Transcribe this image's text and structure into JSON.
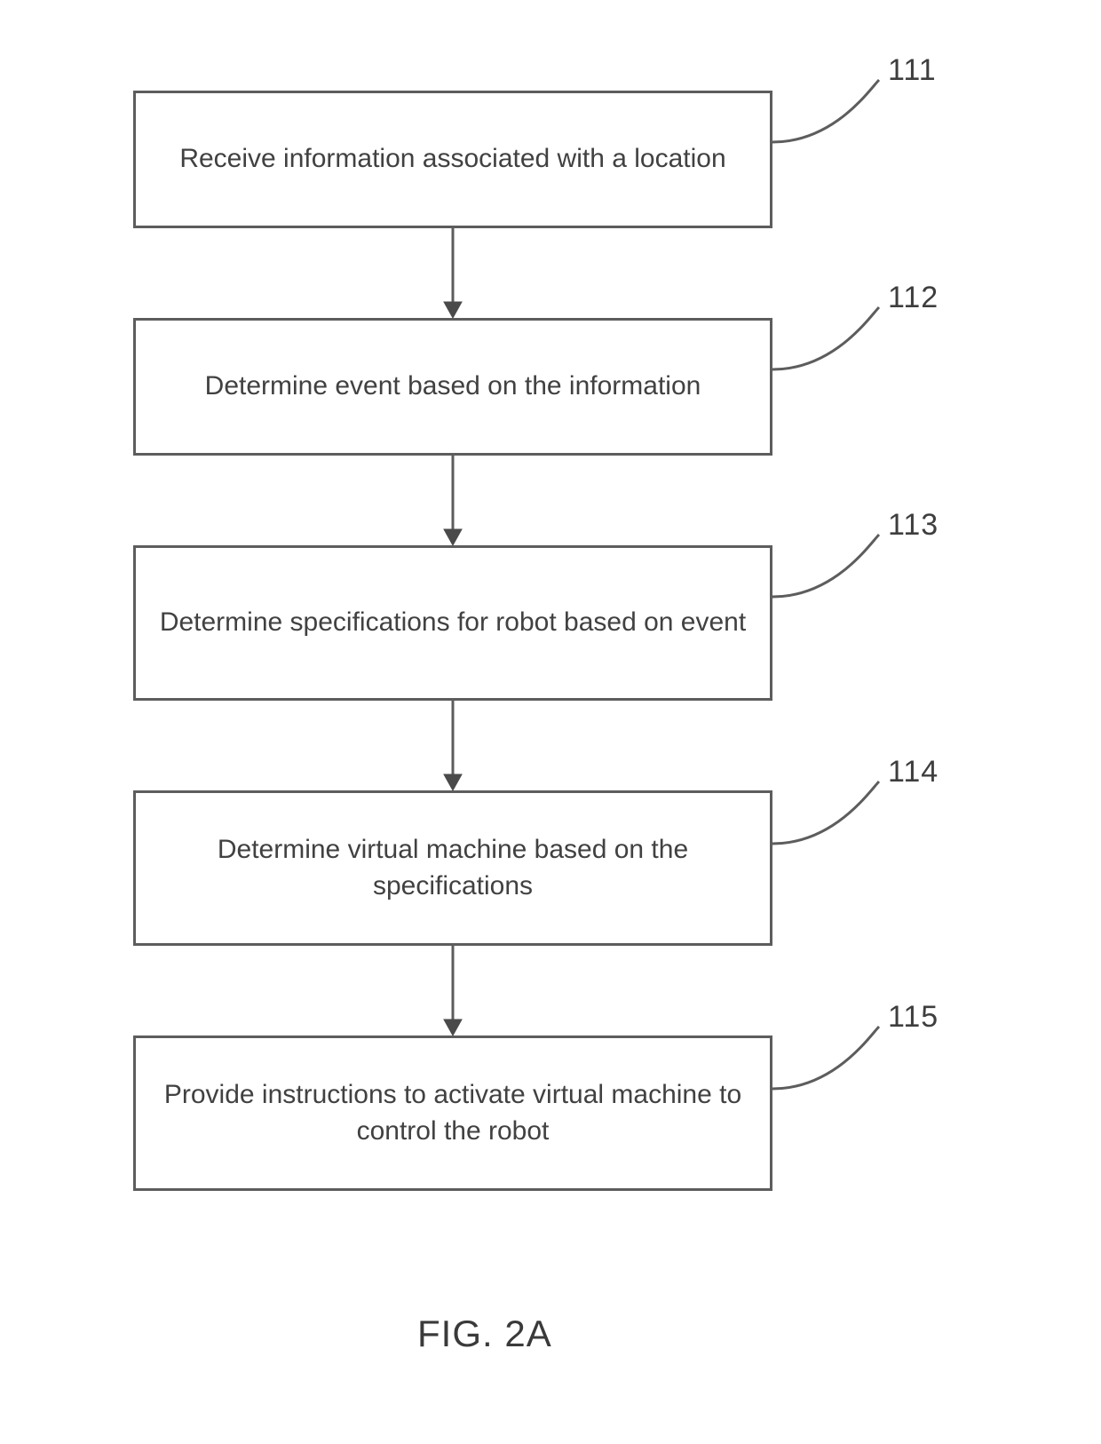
{
  "figure_label": "FIG. 2A",
  "steps": [
    {
      "ref": "111",
      "text": "Receive information associated with a location"
    },
    {
      "ref": "112",
      "text": "Determine event based on the information"
    },
    {
      "ref": "113",
      "text": "Determine specifications for robot based on event"
    },
    {
      "ref": "114",
      "text": "Determine virtual machine based on the specifications"
    },
    {
      "ref": "115",
      "text": "Provide instructions to activate virtual machine to control the robot"
    }
  ]
}
